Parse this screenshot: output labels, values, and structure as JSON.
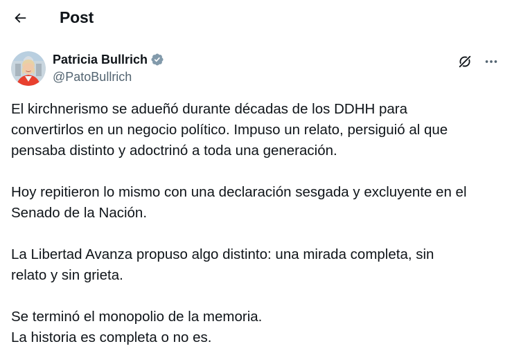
{
  "header": {
    "title": "Post"
  },
  "author": {
    "name": "Patricia Bullrich",
    "handle": "@PatoBullrich",
    "verified": true,
    "verified_color": "#829aab"
  },
  "icons": {
    "back": "arrow-left-icon",
    "grok": "grok-icon",
    "more": "more-horizontal-icon"
  },
  "post": {
    "paragraphs": [
      "El kirchnerismo se adueñó durante décadas de los DDHH para\nconvertirlos en un negocio político. Impuso un relato, persiguió al que\npensaba distinto y adoctrinó a toda una generación.",
      "Hoy repitieron lo mismo con una declaración sesgada y excluyente en el\nSenado de la Nación.",
      "La Libertad Avanza propuso algo distinto: una mirada completa, sin\nrelato y sin grieta.",
      "Se terminó el monopolio de la memoria.\nLa historia es completa o no es."
    ]
  },
  "colors": {
    "text": "#0f1419",
    "secondary": "#536471",
    "background": "#ffffff"
  }
}
